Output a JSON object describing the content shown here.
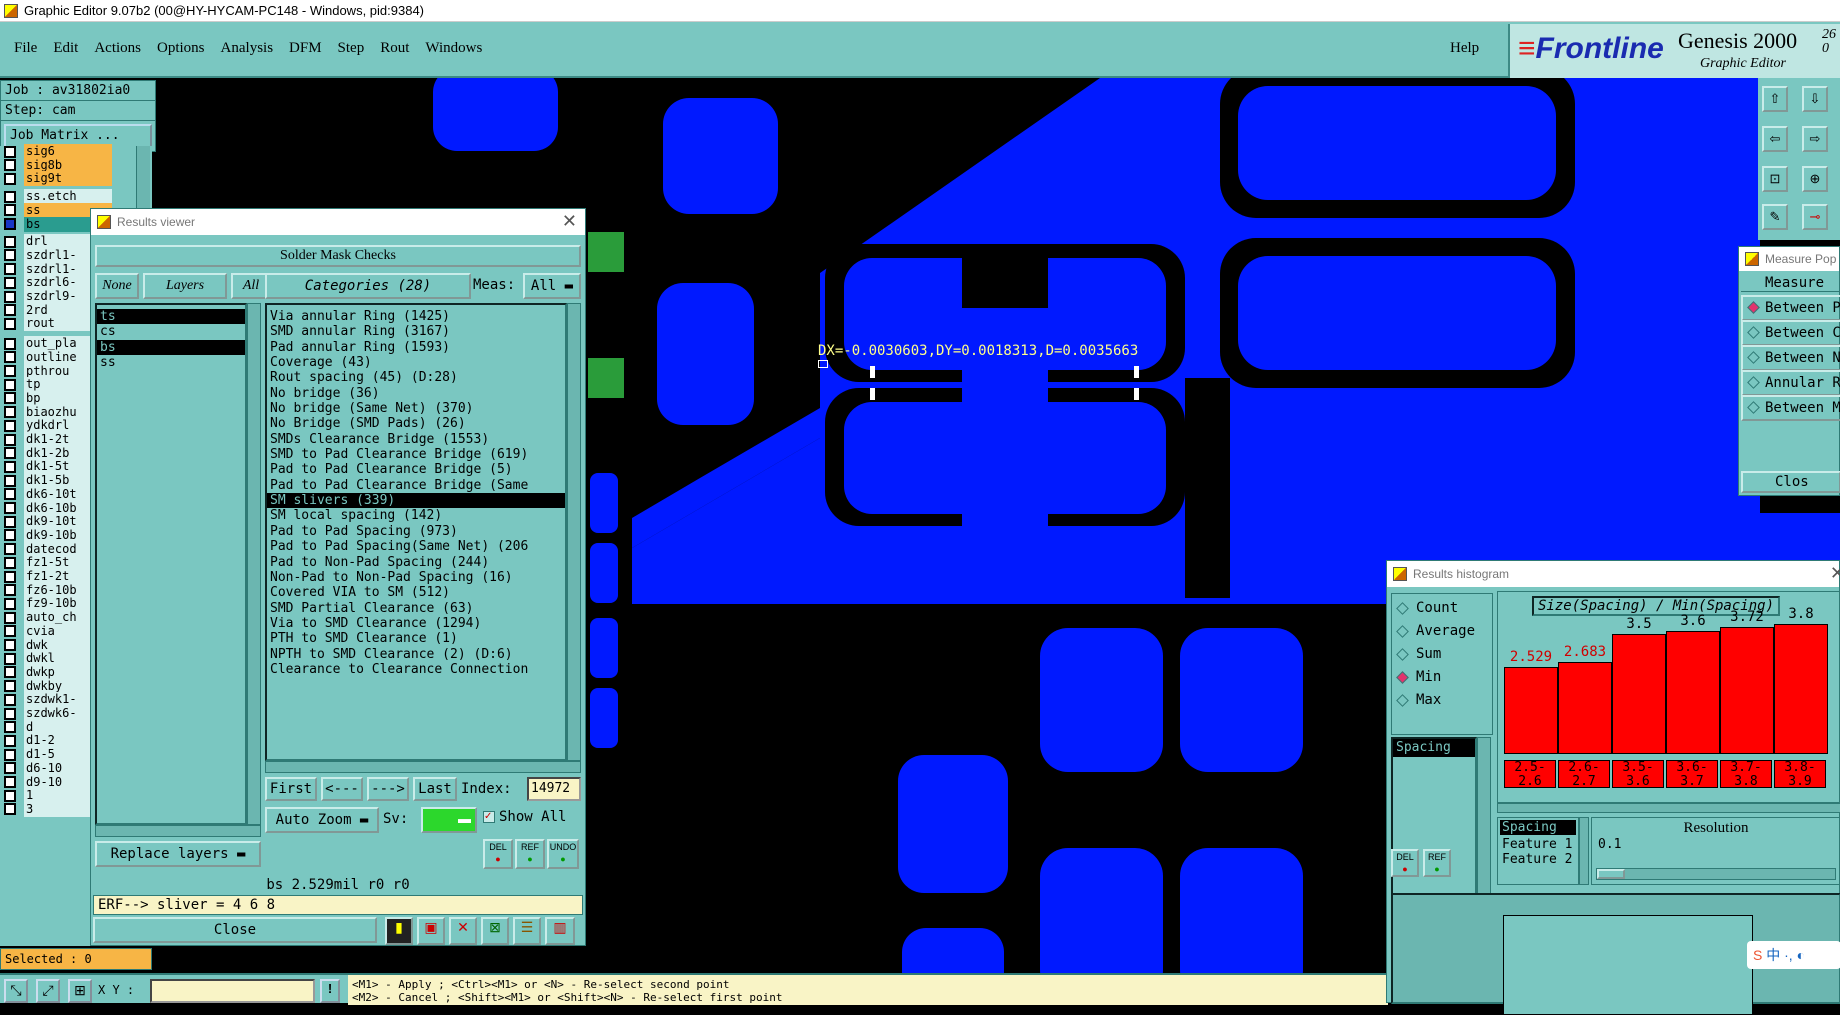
{
  "window": {
    "title": "Graphic Editor 9.07b2 (00@HY-HYCAM-PC148 - Windows, pid:9384)"
  },
  "menubar": {
    "items": [
      "File",
      "Edit",
      "Actions",
      "Options",
      "Analysis",
      "DFM",
      "Step",
      "Rout",
      "Windows"
    ],
    "help": "Help"
  },
  "brand": {
    "logo": "Frontline",
    "product": "Genesis 2000",
    "subtitle": "Graphic Editor",
    "version_top": "26",
    "version_bottom": "0"
  },
  "job": {
    "job_line": "Job : av31802ia0",
    "step_line": "Step: cam",
    "matrix_button": "Job Matrix ..."
  },
  "layers": [
    {
      "name": "sig6",
      "style": "orange"
    },
    {
      "name": "sig8b",
      "style": "orange"
    },
    {
      "name": "sig9t",
      "style": "orange"
    },
    {
      "name": "ss.etch",
      "style": "plain"
    },
    {
      "name": "ss",
      "style": "orange"
    },
    {
      "name": "bs",
      "style": "teal"
    },
    {
      "name": "drl",
      "style": "plain"
    },
    {
      "name": "szdrl1-",
      "style": "plain"
    },
    {
      "name": "szdrl1-",
      "style": "plain"
    },
    {
      "name": "szdrl6-",
      "style": "plain"
    },
    {
      "name": "szdrl9-",
      "style": "plain"
    },
    {
      "name": "2rd",
      "style": "plain"
    },
    {
      "name": "rout",
      "style": "plain"
    },
    {
      "name": "out_pla",
      "style": "plain"
    },
    {
      "name": "outline",
      "style": "plain"
    },
    {
      "name": "pthrou",
      "style": "plain"
    },
    {
      "name": "tp",
      "style": "plain"
    },
    {
      "name": "bp",
      "style": "plain"
    },
    {
      "name": "biaozhu",
      "style": "plain"
    },
    {
      "name": "ydkdrl",
      "style": "plain"
    },
    {
      "name": "dk1-2t",
      "style": "plain"
    },
    {
      "name": "dk1-2b",
      "style": "plain"
    },
    {
      "name": "dk1-5t",
      "style": "plain"
    },
    {
      "name": "dk1-5b",
      "style": "plain"
    },
    {
      "name": "dk6-10t",
      "style": "plain"
    },
    {
      "name": "dk6-10b",
      "style": "plain"
    },
    {
      "name": "dk9-10t",
      "style": "plain"
    },
    {
      "name": "dk9-10b",
      "style": "plain"
    },
    {
      "name": "datecod",
      "style": "plain"
    },
    {
      "name": "fz1-5t",
      "style": "plain"
    },
    {
      "name": "fz1-2t",
      "style": "plain"
    },
    {
      "name": "fz6-10b",
      "style": "plain"
    },
    {
      "name": "fz9-10b",
      "style": "plain"
    },
    {
      "name": "auto_ch",
      "style": "plain"
    },
    {
      "name": "cvia",
      "style": "plain"
    },
    {
      "name": "dwk",
      "style": "plain"
    },
    {
      "name": "dwkl",
      "style": "plain"
    },
    {
      "name": "dwkp",
      "style": "plain"
    },
    {
      "name": "dwkby",
      "style": "plain"
    },
    {
      "name": "szdwk1-",
      "style": "plain"
    },
    {
      "name": "szdwk6-",
      "style": "plain"
    },
    {
      "name": "d",
      "style": "plain"
    },
    {
      "name": "d1-2",
      "style": "plain"
    },
    {
      "name": "d1-5",
      "style": "plain"
    },
    {
      "name": "d6-10",
      "style": "plain"
    },
    {
      "name": "d9-10",
      "style": "plain"
    },
    {
      "name": "1",
      "style": "plain"
    },
    {
      "name": "3",
      "style": "plain"
    }
  ],
  "status": {
    "selected": "Selected : 0",
    "xy_label": "X Y :",
    "xy_value": "",
    "hint1": "<M1> - Apply  ; <Ctrl><M1> or <N> - Re-select second point",
    "hint2": "<M2> - Cancel ; <Shift><M1> or <Shift><N> - Re-select first point"
  },
  "canvas": {
    "measure_readout": "DX=-0.0030603,DY=0.0018313,D=0.0035663"
  },
  "results_viewer": {
    "title": "Results viewer",
    "header": "Solder Mask Checks",
    "none_btn": "None",
    "layers_btn": "Layers",
    "all_btn": "All",
    "categories_btn": "Categories (28)",
    "meas_label": "Meas:",
    "meas_value": "All",
    "layer_items": [
      {
        "name": "ts",
        "selected": true
      },
      {
        "name": "cs",
        "selected": false
      },
      {
        "name": "bs",
        "selected": true
      },
      {
        "name": "ss",
        "selected": false
      }
    ],
    "categories": [
      {
        "text": "Via annular Ring (1425)",
        "selected": false
      },
      {
        "text": "SMD annular Ring (3167)",
        "selected": false
      },
      {
        "text": "Pad annular Ring (1593)",
        "selected": false
      },
      {
        "text": "Coverage (43)",
        "selected": false
      },
      {
        "text": "Rout spacing (45)          (D:28)",
        "selected": false
      },
      {
        "text": "No bridge (36)",
        "selected": false
      },
      {
        "text": "No bridge (Same Net) (370)",
        "selected": false
      },
      {
        "text": "No Bridge (SMD Pads) (26)",
        "selected": false
      },
      {
        "text": "SMDs Clearance Bridge (1553)",
        "selected": false
      },
      {
        "text": "SMD to Pad Clearance Bridge (619)",
        "selected": false
      },
      {
        "text": "Pad to Pad Clearance Bridge (5)",
        "selected": false
      },
      {
        "text": "Pad to Pad Clearance Bridge (Same",
        "selected": false
      },
      {
        "text": "SM slivers (339)",
        "selected": true
      },
      {
        "text": "SM local spacing (142)",
        "selected": false
      },
      {
        "text": "Pad to Pad Spacing (973)",
        "selected": false
      },
      {
        "text": "Pad to Pad Spacing(Same Net) (206",
        "selected": false
      },
      {
        "text": "Pad to Non-Pad Spacing (244)",
        "selected": false
      },
      {
        "text": "Non-Pad to Non-Pad Spacing (16)",
        "selected": false
      },
      {
        "text": "Covered VIA to SM (512)",
        "selected": false
      },
      {
        "text": "SMD Partial Clearance (63)",
        "selected": false
      },
      {
        "text": "Via to SMD Clearance (1294)",
        "selected": false
      },
      {
        "text": "PTH to SMD Clearance (1)",
        "selected": false
      },
      {
        "text": "NPTH to SMD Clearance (2) (D:6)",
        "selected": false
      },
      {
        "text": "Clearance to Clearance Connection",
        "selected": false
      }
    ],
    "nav": {
      "first": "First",
      "prev": "<---",
      "next": "--->",
      "last": "Last",
      "index_label": "Index:",
      "index_value": "14972"
    },
    "auto_zoom": "Auto Zoom",
    "sv_label": "Sv:",
    "show_all": "Show All",
    "replace_layers": "Replace layers",
    "del": "DEL",
    "ref": "REF",
    "undo": "UNDO",
    "info_line": "bs 2.529mil  r0  r0",
    "erf_line": "ERF--> sliver = 4 6 8",
    "close": "Close"
  },
  "measure_popup": {
    "title": "Measure Pop",
    "header": "Measure",
    "options": [
      {
        "label": "Between P",
        "on": true
      },
      {
        "label": "Between C",
        "on": false
      },
      {
        "label": "Between N",
        "on": false
      },
      {
        "label": "Annular R",
        "on": false
      },
      {
        "label": "Between M",
        "on": false
      }
    ],
    "close": "Clos"
  },
  "histogram": {
    "title": "Results histogram",
    "modes": [
      {
        "label": "Count",
        "on": false
      },
      {
        "label": "Average",
        "on": false
      },
      {
        "label": "Sum",
        "on": false
      },
      {
        "label": "Min",
        "on": true
      },
      {
        "label": "Max",
        "on": false
      }
    ],
    "list_item": "Spacing",
    "del": "DEL",
    "ref": "REF",
    "chart_title": "Size(Spacing) / Min(Spacing)",
    "resolution_label": "Resolution",
    "resolution_value": "0.1",
    "legend": [
      "Spacing",
      "Feature 1",
      "Feature 2"
    ]
  },
  "chart_data": {
    "type": "bar",
    "title": "Size(Spacing) / Min(Spacing)",
    "categories": [
      "2.5-2.6",
      "2.6-2.7",
      "3.5-3.6",
      "3.6-3.7",
      "3.7-3.8",
      "3.8-3.9"
    ],
    "category_labels": [
      [
        "2.5-",
        "2.6"
      ],
      [
        "2.6-",
        "2.7"
      ],
      [
        "3.5-",
        "3.6"
      ],
      [
        "3.6-",
        "3.7"
      ],
      [
        "3.7-",
        "3.8"
      ],
      [
        "3.8-",
        "3.9"
      ]
    ],
    "values": [
      2.529,
      2.683,
      3.5,
      3.6,
      3.72,
      3.8
    ],
    "value_labels": [
      "2.529",
      "2.683",
      "3.5",
      "3.6",
      "3.72",
      "3.8"
    ],
    "ylim": [
      0,
      3.8
    ],
    "highlight": [
      true,
      true,
      false,
      false,
      false,
      false
    ],
    "colors": {
      "bar": "#ff0000",
      "low_label": "#d00000",
      "high_label": "#000000"
    }
  },
  "colors": {
    "panel": "#7ac7c1",
    "copper": "#0019ff",
    "highlight_orange": "#f7b545",
    "select_teal": "#2a9c8f"
  },
  "ime": {
    "lang": "中"
  }
}
